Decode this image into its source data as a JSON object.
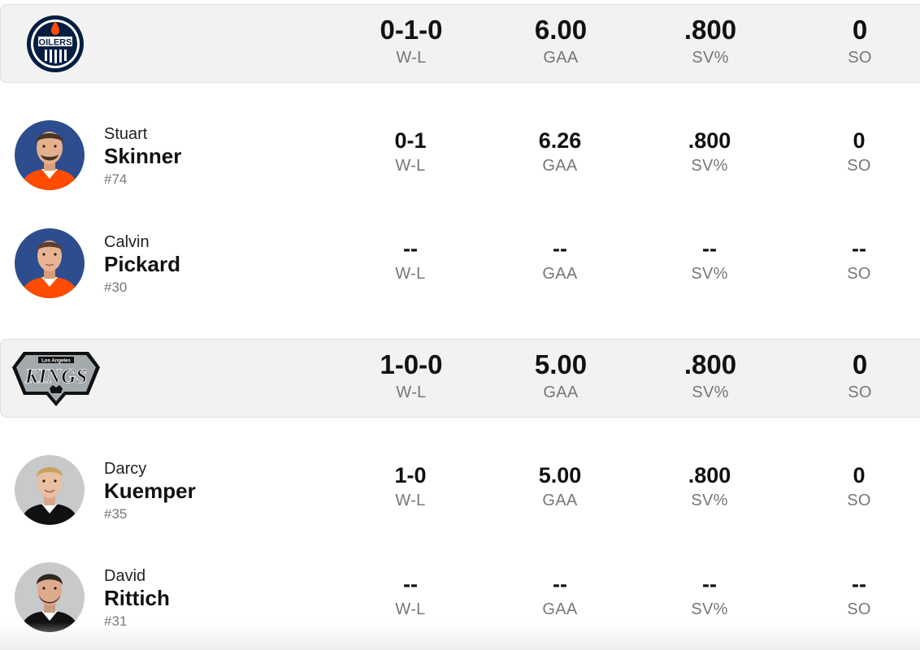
{
  "teams": [
    {
      "name": "Edmonton Oilers",
      "logo_text": "OILERS",
      "colors": {
        "primary": "#041E42",
        "accent": "#FF4C00"
      },
      "stats": {
        "wl": "0-1-0",
        "gaa": "6.00",
        "svp": ".800",
        "so": "0"
      },
      "players": [
        {
          "first": "Stuart",
          "last": "Skinner",
          "number": "#74",
          "stats": {
            "wl": "0-1",
            "gaa": "6.26",
            "svp": ".800",
            "so": "0"
          }
        },
        {
          "first": "Calvin",
          "last": "Pickard",
          "number": "#30",
          "stats": {
            "wl": "--",
            "gaa": "--",
            "svp": "--",
            "so": "--"
          }
        }
      ]
    },
    {
      "name": "Los Angeles Kings",
      "logo_text": "KINGS",
      "logo_subtext": "Los Angeles",
      "colors": {
        "primary": "#111111",
        "accent": "#A2AAAD"
      },
      "stats": {
        "wl": "1-0-0",
        "gaa": "5.00",
        "svp": ".800",
        "so": "0"
      },
      "players": [
        {
          "first": "Darcy",
          "last": "Kuemper",
          "number": "#35",
          "stats": {
            "wl": "1-0",
            "gaa": "5.00",
            "svp": ".800",
            "so": "0"
          }
        },
        {
          "first": "David",
          "last": "Rittich",
          "number": "#31",
          "stats": {
            "wl": "--",
            "gaa": "--",
            "svp": "--",
            "so": "--"
          }
        }
      ]
    }
  ],
  "labels": {
    "wl": "W-L",
    "gaa": "GAA",
    "svp": "SV%",
    "so": "SO"
  }
}
